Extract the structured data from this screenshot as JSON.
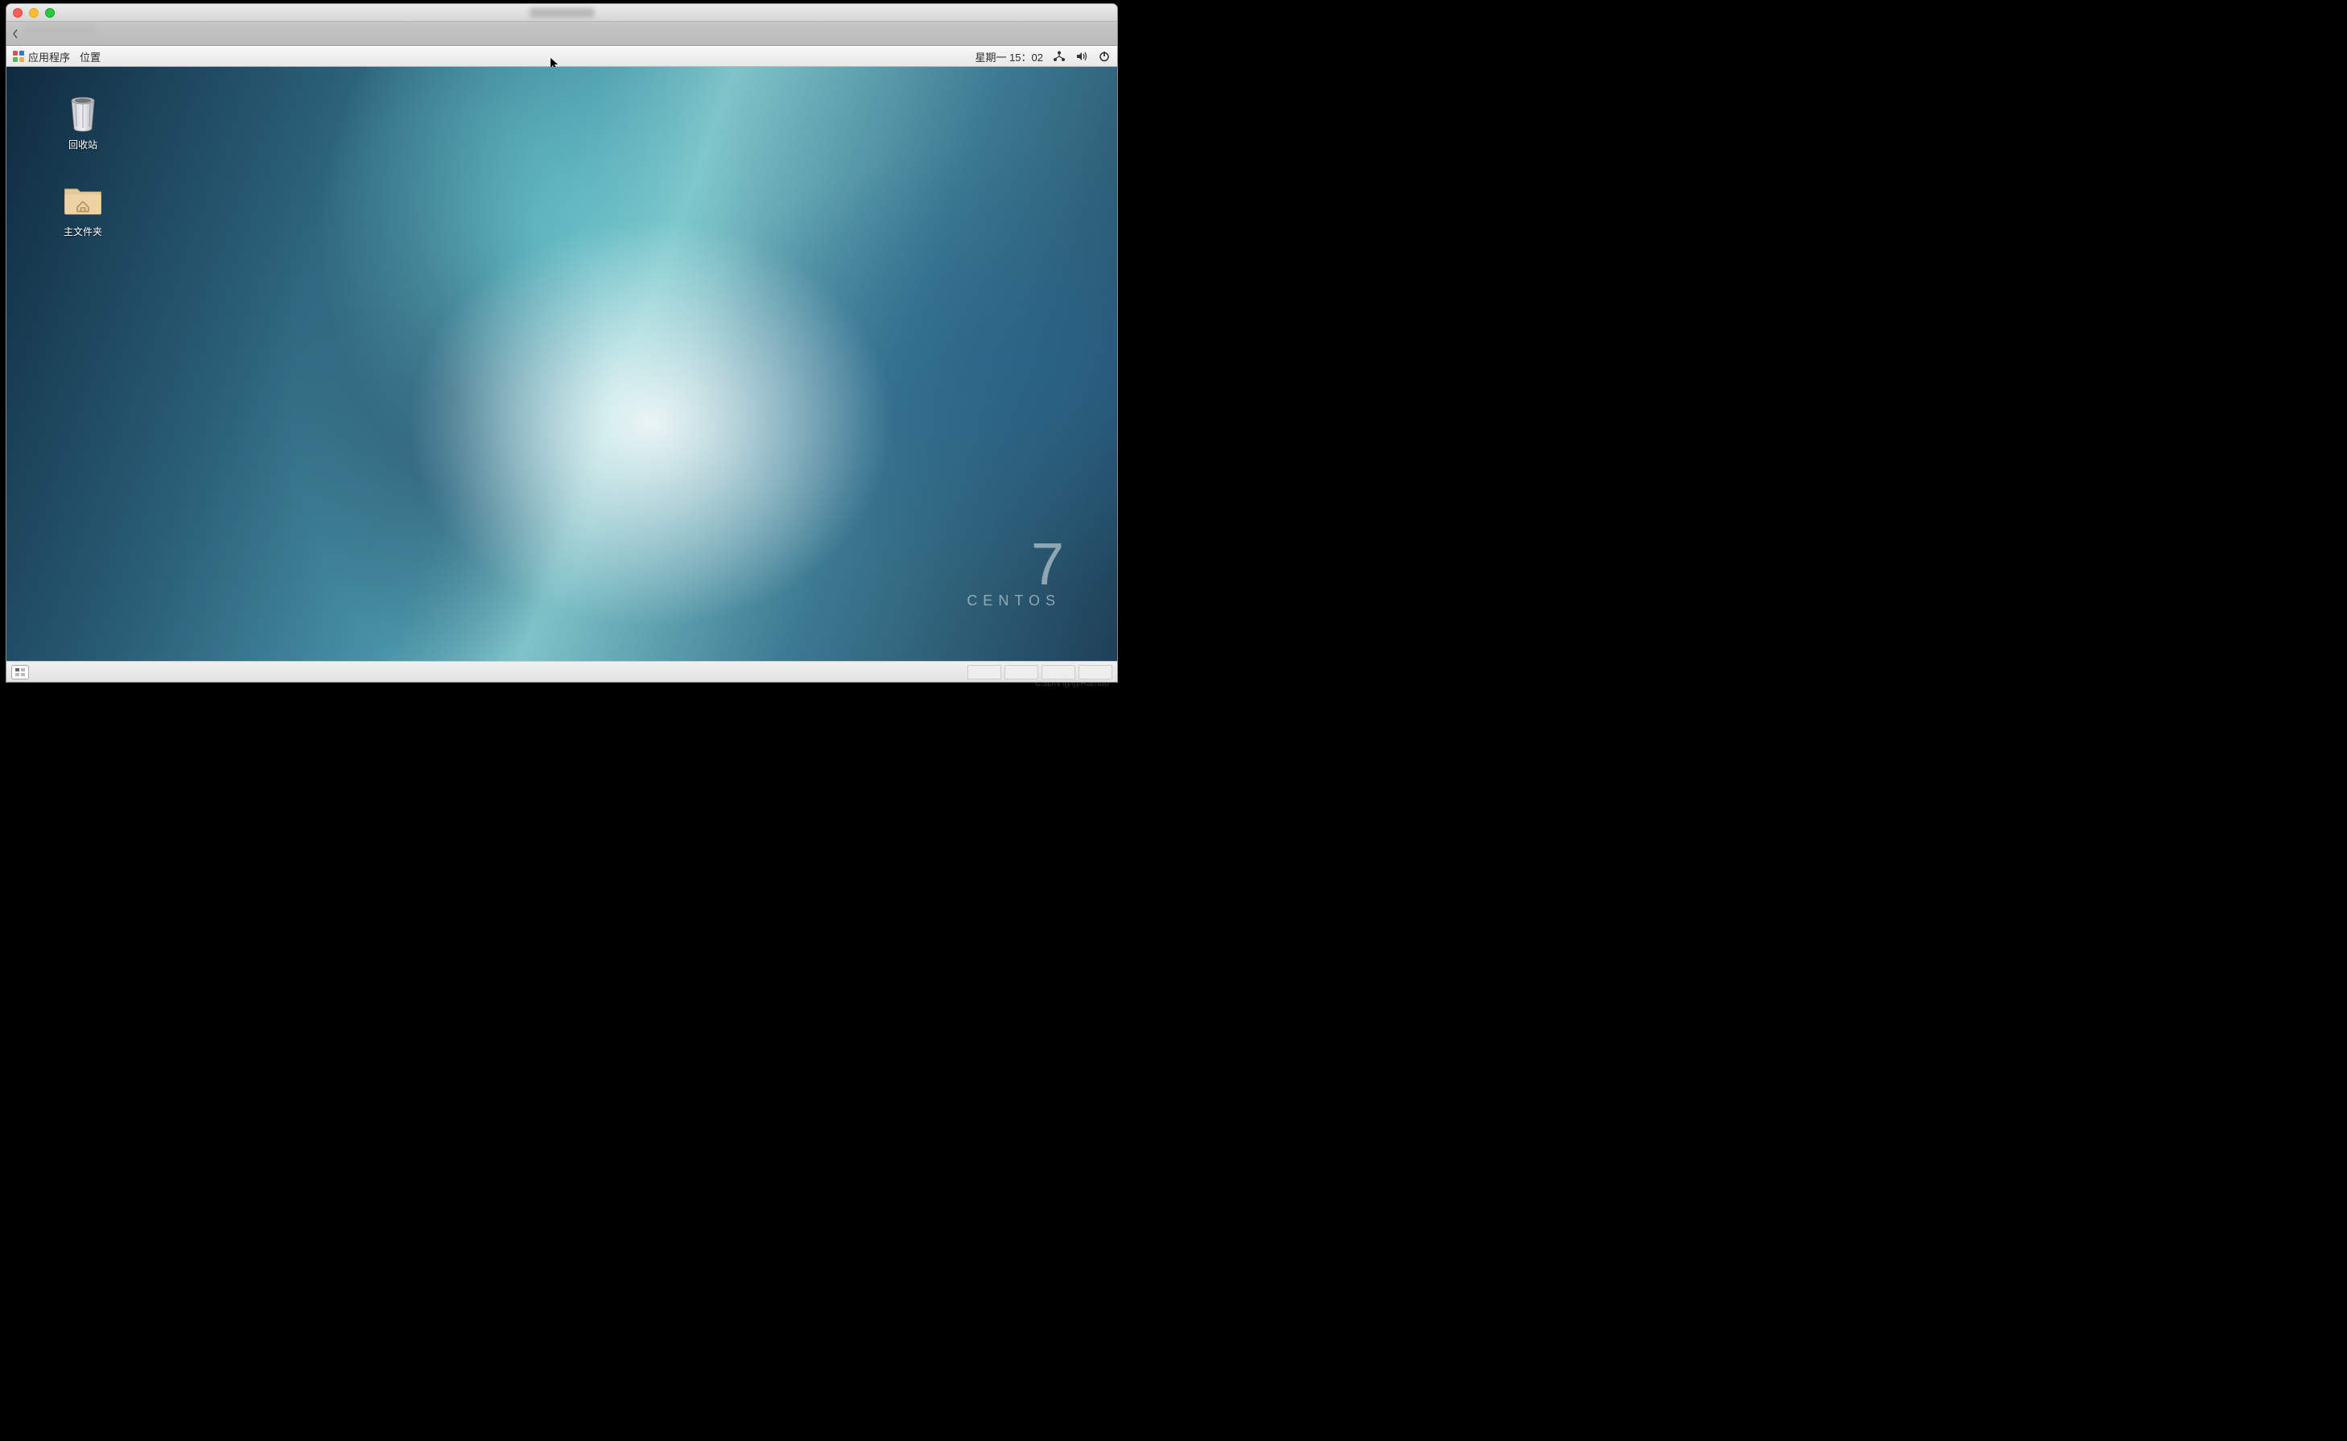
{
  "host_titlebar": {
    "title_blurred": true
  },
  "panel": {
    "apps_label": "应用程序",
    "places_label": "位置",
    "clock": "星期一 15：02"
  },
  "desktop_icons": {
    "trash": {
      "label": "回收站"
    },
    "home": {
      "label": "主文件夹"
    }
  },
  "branding": {
    "version": "7",
    "name": "CENTOS"
  },
  "watermark": "CSDN @@Rambo"
}
